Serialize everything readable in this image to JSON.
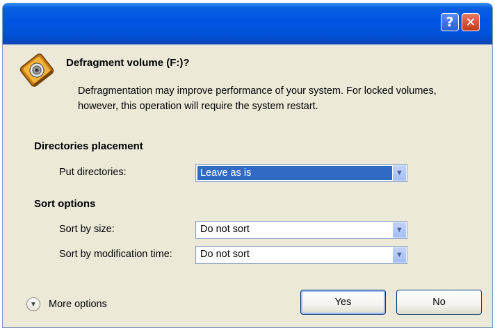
{
  "window": {
    "help_glyph": "?",
    "close_glyph": "✕"
  },
  "dialog": {
    "title": "Defragment volume (F:)?",
    "description": "Defragmentation may improve performance of your system. For locked volumes, however, this operation will require the system restart.",
    "icon": "defragment-drive-icon"
  },
  "directories": {
    "heading": "Directories placement",
    "put_label": "Put directories:",
    "put_value": "Leave as is"
  },
  "sort": {
    "heading": "Sort options",
    "size_label": "Sort by size:",
    "size_value": "Do not sort",
    "mtime_label": "Sort by modification time:",
    "mtime_value": "Do not sort"
  },
  "footer": {
    "more_options": "More options",
    "yes": "Yes",
    "no": "No"
  },
  "colors": {
    "titlebar": "#0054e3",
    "dialog_bg": "#ece9d8",
    "selection": "#316ac5"
  }
}
